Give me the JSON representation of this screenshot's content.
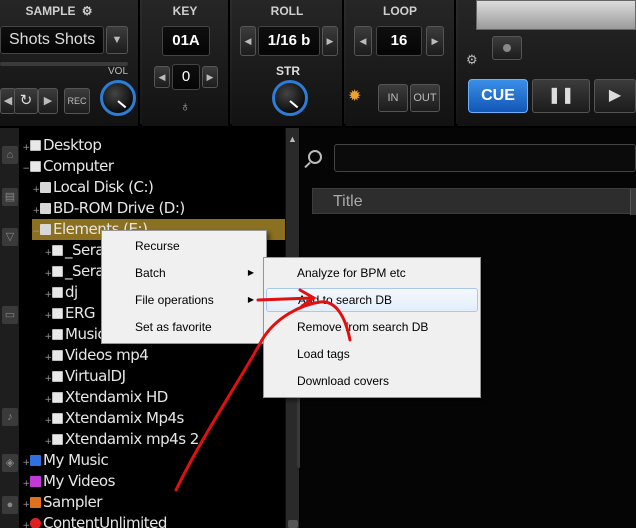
{
  "deck": {
    "sample": {
      "title": "SAMPLE",
      "select_value": "Shots Shots",
      "vol_label": "VOL",
      "rec_label": "REC"
    },
    "key": {
      "title": "KEY",
      "value": "01A",
      "pitch_value": "0"
    },
    "roll": {
      "title": "ROLL",
      "value": "1/16 b"
    },
    "loop": {
      "title": "LOOP",
      "value": "16"
    },
    "str": {
      "label": "STR"
    },
    "in_label": "IN",
    "out_label": "OUT",
    "cue_label": "CUE"
  },
  "tree": {
    "items": [
      {
        "label": "Desktop"
      },
      {
        "label": "Computer"
      },
      {
        "label": "Local Disk (C:)"
      },
      {
        "label": "BD-ROM Drive (D:)"
      },
      {
        "label": "Elements (E:)"
      },
      {
        "label": "_Sera"
      },
      {
        "label": "_Sera"
      },
      {
        "label": "dj"
      },
      {
        "label": "ERG"
      },
      {
        "label": "Music"
      },
      {
        "label": "Videos mp4"
      },
      {
        "label": "VirtualDJ"
      },
      {
        "label": "Xtendamix HD"
      },
      {
        "label": "Xtendamix Mp4s"
      },
      {
        "label": "Xtendamix mp4s 2"
      },
      {
        "label": "My Music"
      },
      {
        "label": "My Videos"
      },
      {
        "label": "Sampler"
      },
      {
        "label": "ContentUnlimited"
      }
    ],
    "folders_tab": "folders"
  },
  "browser": {
    "column_title": "Title"
  },
  "context_menu": {
    "items": [
      {
        "label": "Recurse"
      },
      {
        "label": "Batch"
      },
      {
        "label": "File operations"
      },
      {
        "label": "Set as favorite"
      }
    ]
  },
  "submenu": {
    "items": [
      {
        "label": "Analyze for BPM etc"
      },
      {
        "label": "Add to search DB"
      },
      {
        "label": "Remove from search DB"
      },
      {
        "label": "Load tags"
      },
      {
        "label": "Download covers"
      }
    ]
  },
  "colors": {
    "accent": "#2d7cd6",
    "selection": "#8a7020",
    "annotation": "#e01010"
  }
}
